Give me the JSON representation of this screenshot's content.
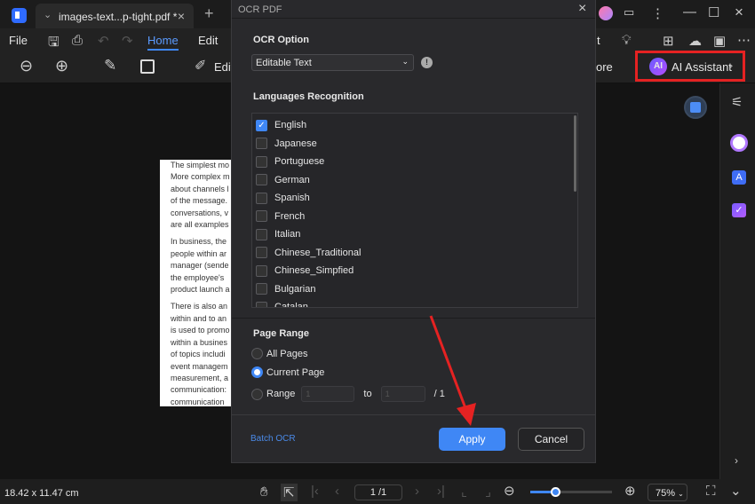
{
  "app": {
    "tab_title": "images-text...p-tight.pdf *",
    "colors": {
      "accent": "#3f87f5",
      "highlight": "#e52222"
    }
  },
  "menu": {
    "file": "File",
    "home": "Home",
    "edit": "Edit",
    "more": "ore",
    "ai_assistant": "AI Assistant",
    "ai_badge": "AI",
    "edit_tool": "Edit",
    "partial": "t"
  },
  "document": {
    "paragraphs": [
      [
        "The simplest mo",
        "More complex m",
        "about channels l",
        "of the message.",
        "conversations, v",
        "are all examples"
      ],
      [
        "In business, the",
        "people within ar",
        "manager (sende",
        "the employee's",
        "product launch a"
      ],
      [
        "There is also an",
        "within and to an",
        "is used to promo",
        "within a busines",
        "of topics includi",
        "event managem",
        "measurement, a",
        "communication:",
        "communication"
      ]
    ]
  },
  "dialog": {
    "title": "OCR PDF",
    "ocr_option_label": "OCR Option",
    "ocr_option_value": "Editable Text",
    "languages_label": "Languages Recognition",
    "languages": [
      {
        "name": "English",
        "checked": true
      },
      {
        "name": "Japanese",
        "checked": false
      },
      {
        "name": "Portuguese",
        "checked": false
      },
      {
        "name": "German",
        "checked": false
      },
      {
        "name": "Spanish",
        "checked": false
      },
      {
        "name": "French",
        "checked": false
      },
      {
        "name": "Italian",
        "checked": false
      },
      {
        "name": "Chinese_Traditional",
        "checked": false
      },
      {
        "name": "Chinese_Simpfied",
        "checked": false
      },
      {
        "name": "Bulgarian",
        "checked": false
      },
      {
        "name": "Catalan",
        "checked": false
      }
    ],
    "page_range_label": "Page Range",
    "all_pages": "All Pages",
    "current_page": "Current Page",
    "range": "Range",
    "range_from": "1",
    "range_to_label": "to",
    "range_to": "1",
    "range_total": "/ 1",
    "selected_range": "Current Page",
    "batch_ocr": "Batch OCR",
    "apply": "Apply",
    "cancel": "Cancel"
  },
  "status": {
    "dimensions": "18.42 x 11.47 cm",
    "page": "1 /1",
    "zoom": "75%",
    "zoom_slider_percent": 30
  }
}
